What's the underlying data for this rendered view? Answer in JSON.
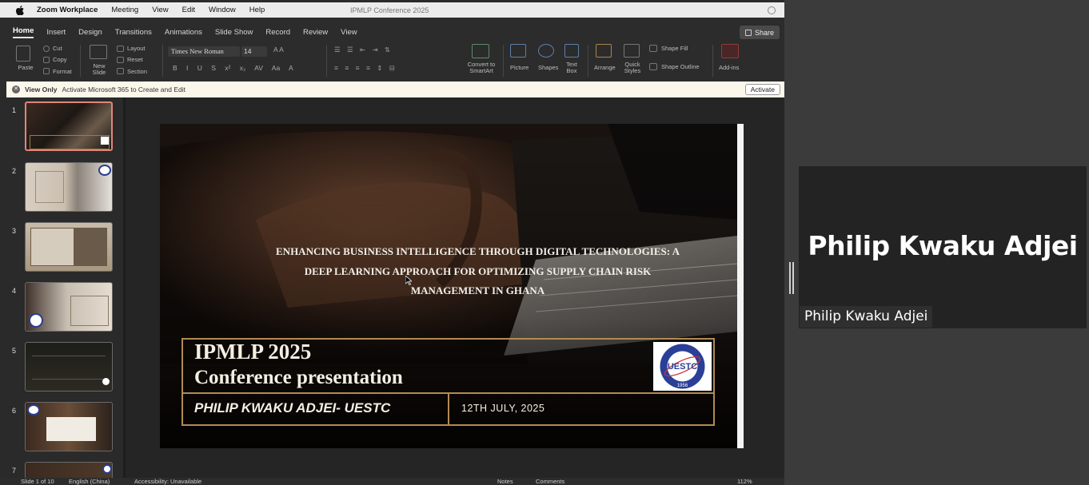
{
  "menubar": {
    "app": "Zoom Workplace",
    "items": [
      "Meeting",
      "View",
      "Edit",
      "Window",
      "Help"
    ],
    "window_title": "IPMLP Conference 2025"
  },
  "ppt": {
    "tabs": [
      "Home",
      "Insert",
      "Design",
      "Transitions",
      "Animations",
      "Slide Show",
      "Record",
      "Review",
      "View"
    ],
    "active_tab": "Home",
    "share_label": "Share",
    "ribbon": {
      "paste": "Paste",
      "cut": "Cut",
      "copy": "Copy",
      "format": "Format",
      "new_slide": "New Slide",
      "layout": "Layout",
      "reset": "Reset",
      "section": "Section",
      "font": "Times New Roman",
      "size": "14",
      "convert_smartart": "Convert to SmartArt",
      "picture": "Picture",
      "shapes": "Shapes",
      "text_box": "Text Box",
      "arrange": "Arrange",
      "quick_styles": "Quick Styles",
      "shape_fill": "Shape Fill",
      "shape_outline": "Shape Outline",
      "addins": "Add-ins"
    },
    "viewonly": {
      "label": "View Only",
      "message": "Activate Microsoft 365 to Create and Edit",
      "button": "Activate"
    },
    "thumbnails": [
      {
        "num": "1",
        "selected": true
      },
      {
        "num": "2"
      },
      {
        "num": "3"
      },
      {
        "num": "4"
      },
      {
        "num": "5"
      },
      {
        "num": "6"
      },
      {
        "num": "7"
      }
    ],
    "slide": {
      "title_lines": [
        "ENHANCING BUSINESS INTELLIGENCE THROUGH DIGITAL TECHNOLOGIES: A",
        "DEEP LEARNING APPROACH FOR OPTIMIZING SUPPLY CHAIN RISK",
        "MANAGEMENT IN GHANA"
      ],
      "conf_title": "IPMLP 2025",
      "conf_subtitle": "Conference presentation",
      "presenter": "PHILIP KWAKU ADJEI- UESTC",
      "date": "12TH JULY, 2025",
      "logo_text": "UESTC",
      "logo_year": "1956"
    },
    "status": {
      "slide_count": "Slide 1 of 10",
      "language": "English (China)",
      "accessibility": "Accessibility: Unavailable",
      "notes": "Notes",
      "comments": "Comments",
      "zoom": "112%"
    }
  },
  "participant": {
    "display_name": "Philip Kwaku Adjei",
    "label": "Philip Kwaku Adjei"
  }
}
